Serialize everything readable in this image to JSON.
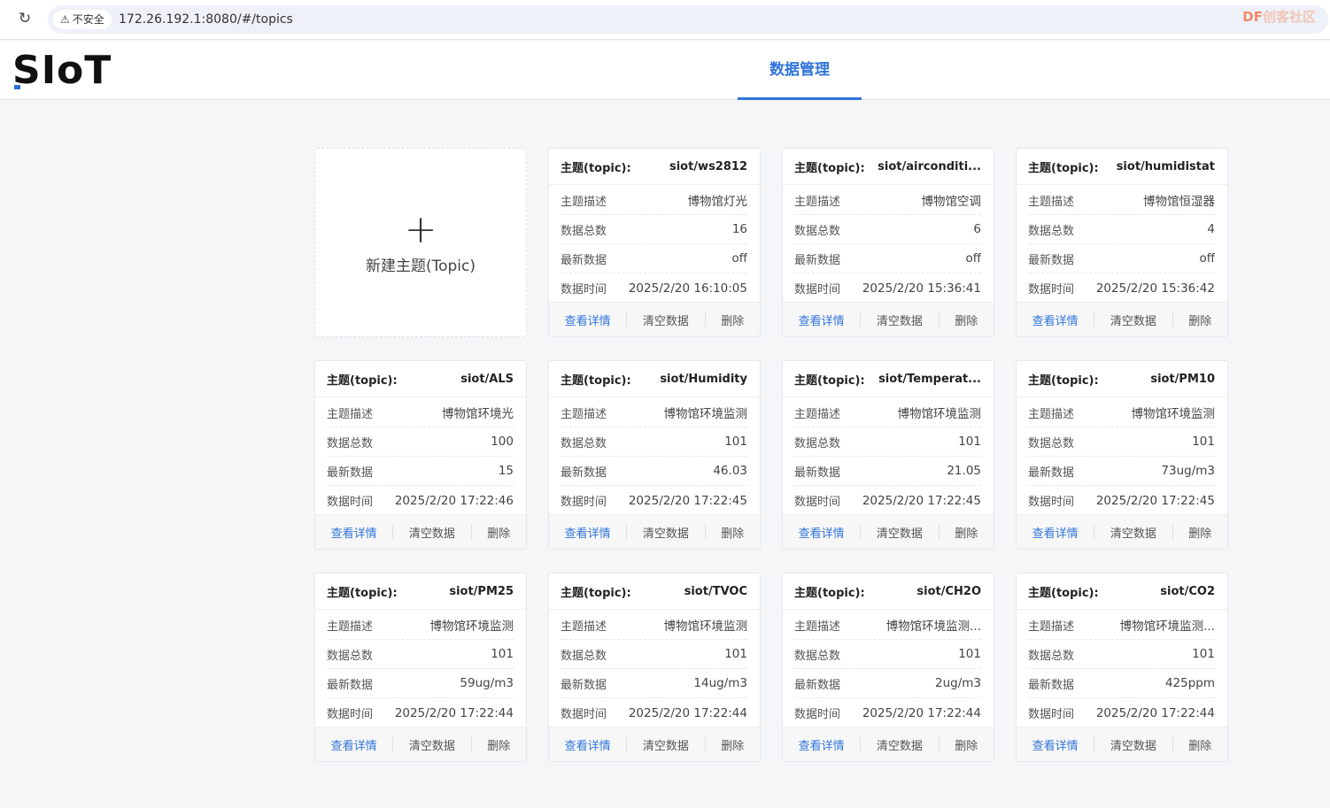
{
  "browser": {
    "insecure_label": "不安全",
    "url": "172.26.192.1:8080/#/topics",
    "watermark_df": "DF",
    "watermark_text": "创客社区"
  },
  "header": {
    "logo": "SIoT",
    "nav_tab": "数据管理"
  },
  "new_card": {
    "plus": "+",
    "label": "新建主题(Topic)"
  },
  "labels": {
    "topic_key": "主题(topic):",
    "desc": "主题描述",
    "count": "数据总数",
    "latest": "最新数据",
    "time": "数据时间",
    "view": "查看详情",
    "clear": "清空数据",
    "delete": "删除"
  },
  "topics": [
    {
      "topic": "siot/ws2812",
      "desc": "博物馆灯光",
      "count": "16",
      "latest": "off",
      "time": "2025/2/20 16:10:05"
    },
    {
      "topic": "siot/airconditi...",
      "desc": "博物馆空调",
      "count": "6",
      "latest": "off",
      "time": "2025/2/20 15:36:41"
    },
    {
      "topic": "siot/humidistat",
      "desc": "博物馆恒湿器",
      "count": "4",
      "latest": "off",
      "time": "2025/2/20 15:36:42"
    },
    {
      "topic": "siot/ALS",
      "desc": "博物馆环境光",
      "count": "100",
      "latest": "15",
      "time": "2025/2/20 17:22:46"
    },
    {
      "topic": "siot/Humidity",
      "desc": "博物馆环境监测",
      "count": "101",
      "latest": "46.03",
      "time": "2025/2/20 17:22:45"
    },
    {
      "topic": "siot/Temperat...",
      "desc": "博物馆环境监测",
      "count": "101",
      "latest": "21.05",
      "time": "2025/2/20 17:22:45"
    },
    {
      "topic": "siot/PM10",
      "desc": "博物馆环境监测",
      "count": "101",
      "latest": "73ug/m3",
      "time": "2025/2/20 17:22:45"
    },
    {
      "topic": "siot/PM25",
      "desc": "博物馆环境监测",
      "count": "101",
      "latest": "59ug/m3",
      "time": "2025/2/20 17:22:44"
    },
    {
      "topic": "siot/TVOC",
      "desc": "博物馆环境监测",
      "count": "101",
      "latest": "14ug/m3",
      "time": "2025/2/20 17:22:44"
    },
    {
      "topic": "siot/CH2O",
      "desc": "博物馆环境监测...",
      "count": "101",
      "latest": "2ug/m3",
      "time": "2025/2/20 17:22:44"
    },
    {
      "topic": "siot/CO2",
      "desc": "博物馆环境监测...",
      "count": "101",
      "latest": "425ppm",
      "time": "2025/2/20 17:22:44"
    }
  ],
  "colors": {
    "accent": "#2f74d9",
    "page_bg": "#f5f6f7",
    "card_bg": "#ffffff"
  }
}
